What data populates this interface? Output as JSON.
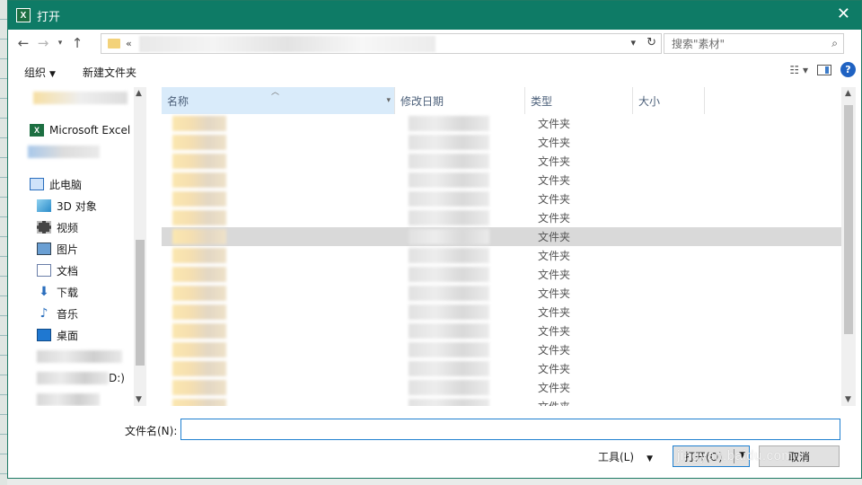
{
  "window": {
    "title": "打开",
    "app_icon_letter": "X"
  },
  "navbar": {
    "address_prefix": "«",
    "search_placeholder": "搜索\"素材\""
  },
  "toolbar": {
    "organize": "组织",
    "new_folder": "新建文件夹"
  },
  "sidebar": {
    "excel": "Microsoft Excel",
    "this_pc": "此电脑",
    "items": [
      "3D 对象",
      "视频",
      "图片",
      "文档",
      "下载",
      "音乐",
      "桌面"
    ],
    "drive_suffix": "D:)"
  },
  "columns": {
    "name": "名称",
    "date": "修改日期",
    "type": "类型",
    "size": "大小"
  },
  "rows": [
    {
      "type": "文件夹"
    },
    {
      "type": "文件夹"
    },
    {
      "type": "文件夹"
    },
    {
      "type": "文件夹"
    },
    {
      "type": "文件夹"
    },
    {
      "type": "文件夹"
    },
    {
      "type": "文件夹"
    },
    {
      "type": "文件夹"
    },
    {
      "type": "文件夹"
    },
    {
      "type": "文件夹"
    },
    {
      "type": "文件夹"
    },
    {
      "type": "文件夹"
    },
    {
      "type": "文件夹"
    },
    {
      "type": "文件夹"
    },
    {
      "type": "文件夹"
    },
    {
      "type": "文件夹"
    }
  ],
  "highlighted_row": 6,
  "footer": {
    "filename_label": "文件名(N):",
    "filename_value": "",
    "tools": "工具(L)",
    "open": "打开(O)",
    "cancel": "取消",
    "watermark": "jingyan.baidu.com"
  },
  "colors": {
    "titlebar": "#0e7b66",
    "accent": "#1e7fd0",
    "selected_header": "#d9ebfa"
  }
}
